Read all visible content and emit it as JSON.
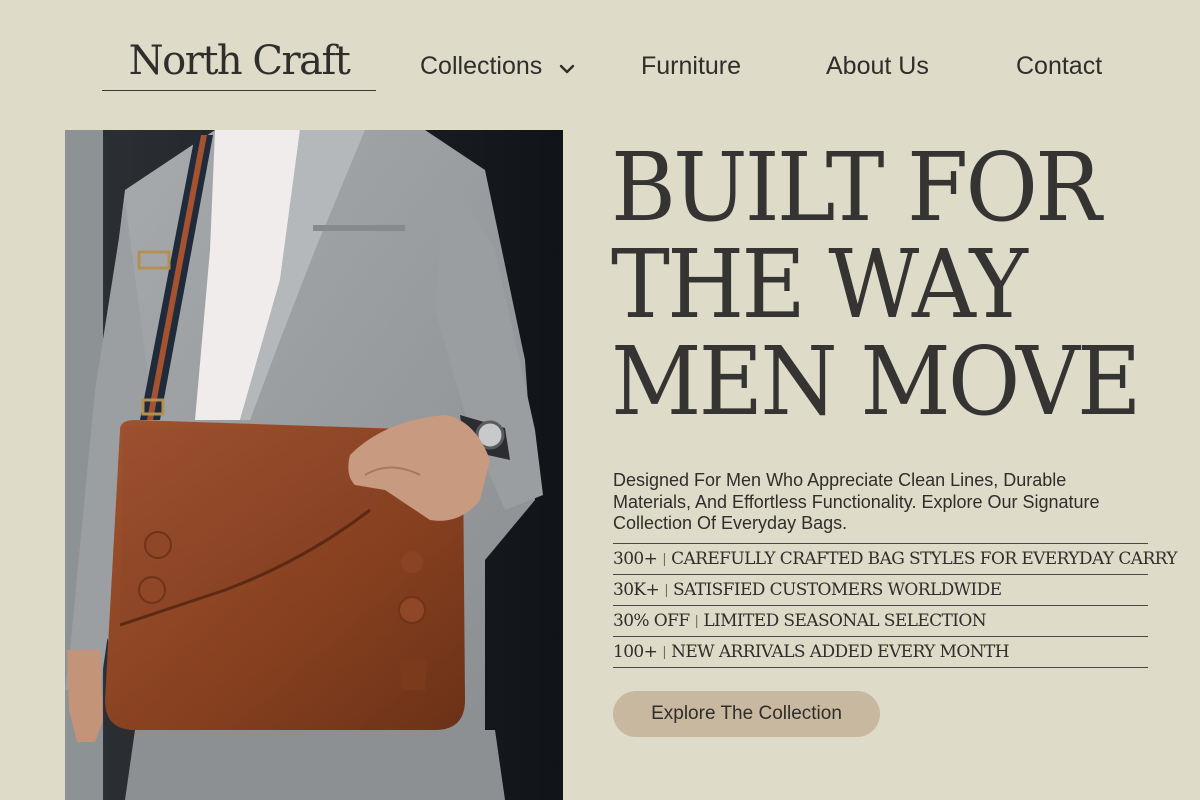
{
  "brand": {
    "name": "North Craft"
  },
  "nav": {
    "items": [
      {
        "label": "Collections",
        "has_dropdown": true,
        "icon": "chevron-down-icon"
      },
      {
        "label": "Furniture"
      },
      {
        "label": "About Us"
      },
      {
        "label": "Contact"
      }
    ]
  },
  "hero": {
    "image_alt": "Man in grey suit carrying a brown leather messenger bag",
    "headline_lines": [
      "BUILT FOR",
      "THE WAY",
      "MEN MOVE"
    ],
    "description": "Designed For Men Who Appreciate Clean Lines, Durable Materials, And Effortless Functionality. Explore Our Signature Collection Of Everyday Bags.",
    "stats": [
      {
        "value": "300+",
        "label": "CAREFULLY CRAFTED BAG STYLES FOR EVERYDAY CARRY"
      },
      {
        "value": "30K+",
        "label": "SATISFIED CUSTOMERS WORLDWIDE"
      },
      {
        "value": "30% OFF",
        "label": "LIMITED SEASONAL SELECTION"
      },
      {
        "value": "100+",
        "label": "NEW ARRIVALS ADDED EVERY MONTH"
      }
    ],
    "cta_label": "Explore The Collection"
  },
  "colors": {
    "background": "#dedbc9",
    "text": "#2f2e2b",
    "cta_background": "#c8b8a0",
    "bag_leather": "#8a4226",
    "suit_grey": "#9a9ea0"
  }
}
